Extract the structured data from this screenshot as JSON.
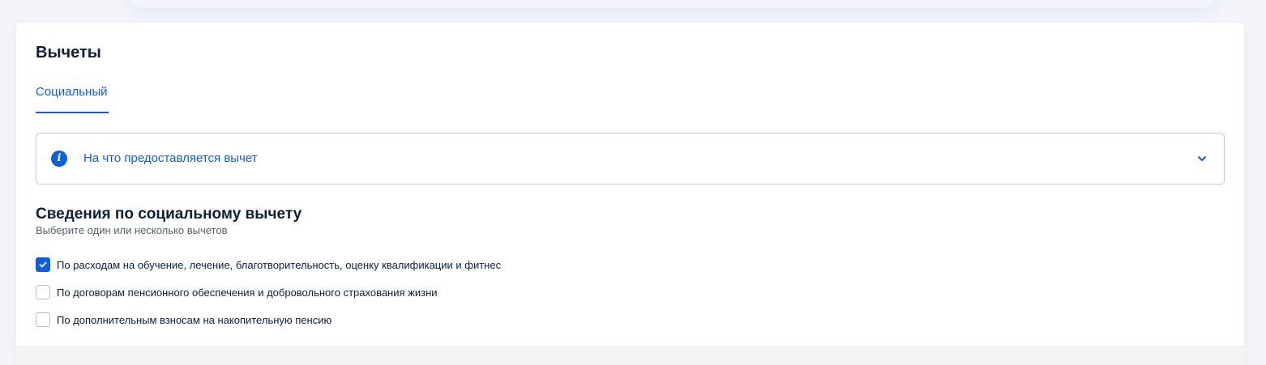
{
  "card": {
    "title": "Вычеты"
  },
  "tabs": [
    {
      "label": "Социальный",
      "active": true
    }
  ],
  "accordion": {
    "icon": "info-icon",
    "icon_glyph": "i",
    "label": "На что предоставляется вычет",
    "expanded": false,
    "chevron_icon": "chevron-down-icon"
  },
  "section": {
    "title": "Сведения по социальному вычету",
    "subtitle": "Выберите один или несколько вычетов"
  },
  "checkboxes": [
    {
      "label": "По расходам на обучение, лечение, благотворительность, оценку квалификации и фитнес",
      "checked": true
    },
    {
      "label": "По договорам пенсионного обеспечения и добровольного страхования жизни",
      "checked": false
    },
    {
      "label": "По дополнительным взносам на накопительную пенсию",
      "checked": false
    }
  ],
  "colors": {
    "accent": "#0d5ee0",
    "text": "#0b1f35",
    "muted": "#55606e",
    "border": "#b8cbe0",
    "background": "#f3f5fb"
  }
}
